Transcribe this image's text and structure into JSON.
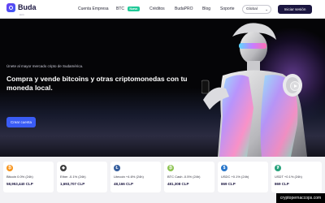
{
  "brand": {
    "name": "Buda",
    "sub": ".com"
  },
  "nav": {
    "links": [
      "Cuenta Empresa",
      "BTC",
      "Créditos",
      "BudaPRO",
      "Blog",
      "Soporte"
    ],
    "badge": "Nuevo",
    "language": "Global",
    "login": "Iniciar sesión"
  },
  "hero": {
    "subtitle": "Únete al mayor mercado cripto de Sudamérica.",
    "title": "Compra y vende bitcoins y otras criptomonedas con tu moneda local.",
    "cta": "Crear cuenta"
  },
  "coins": [
    {
      "change": "Bitcoin 0.0% (24h)",
      "price": "58,953,440 CLP",
      "icon": "bitcoin-icon",
      "symbol": "₿",
      "color": "#f7931a"
    },
    {
      "change": "Ether -0.1% (24h)",
      "price": "1,693,707 CLP",
      "icon": "ether-icon",
      "symbol": "◆",
      "color": "#3c3c3d"
    },
    {
      "change": "Litecoin +4.6% (24h)",
      "price": "48,166 CLP",
      "icon": "litecoin-icon",
      "symbol": "Ł",
      "color": "#345d9d"
    },
    {
      "change": "BTC Cash -0.5% (24h)",
      "price": "481,308 CLP",
      "icon": "bitcoin-cash-icon",
      "symbol": "₿",
      "color": "#8dc351"
    },
    {
      "change": "USDC +0.1% (24h)",
      "price": "869 CLP",
      "icon": "usdc-icon",
      "symbol": "$",
      "color": "#2775ca"
    },
    {
      "change": "USDT +0.1% (24h)",
      "price": "869 CLP",
      "icon": "usdt-icon",
      "symbol": "₮",
      "color": "#26a17b"
    }
  ],
  "watermark": "cryptopernaccops.com"
}
